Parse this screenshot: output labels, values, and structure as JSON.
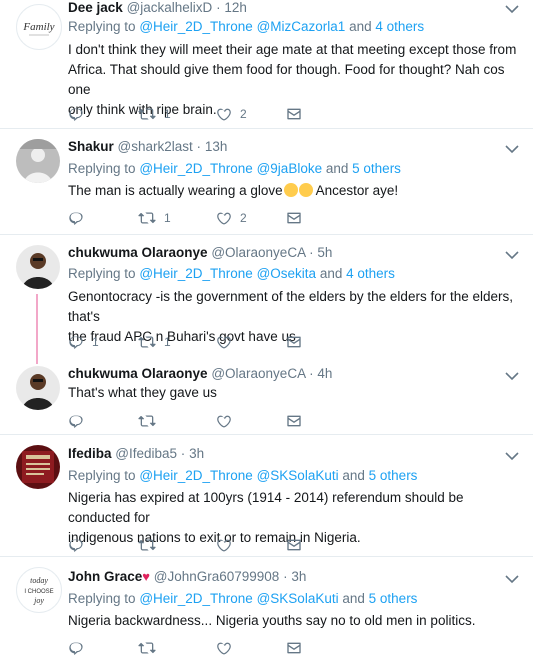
{
  "reply_prefix": "Replying to",
  "and_word": "and",
  "tweets": [
    {
      "name": "Dee jack",
      "handle": "@jackalhelixD",
      "time": "12h",
      "mentions": [
        "@Heir_2D_Throne",
        "@MizCazorla1"
      ],
      "others": "4 others",
      "text_lines": [
        "I don't think they will meet their age mate at that meeting except those from",
        "Africa. That should give them food for though. Food for thought? Nah cos one",
        "only think with ripe brain."
      ],
      "retweets": "1",
      "likes": "2",
      "avatar_text": "Family"
    },
    {
      "name": "Shakur",
      "handle": "@shark2last",
      "time": "13h",
      "mentions": [
        "@Heir_2D_Throne",
        "@9jaBloke"
      ],
      "others": "5 others",
      "text_before": "The man is actually wearing a glove",
      "text_after": " Ancestor aye!",
      "retweets": "1",
      "likes": "2"
    },
    {
      "name": "chukwuma Olaraonye",
      "handle": "@OlaraonyeCA",
      "time": "5h",
      "mentions": [
        "@Heir_2D_Throne",
        "@Osekita"
      ],
      "others": "4 others",
      "text_lines": [
        "Genontocracy -is the government of the elders by the elders for the elders, that's",
        "the fraud APC n Buhari's govt have us"
      ],
      "replies": "1",
      "retweets": "1"
    },
    {
      "name": "chukwuma Olaraonye",
      "handle": "@OlaraonyeCA",
      "time": "4h",
      "text_lines": [
        "That's what they gave us"
      ]
    },
    {
      "name": "Ifediba",
      "handle": "@Ifediba5",
      "time": "3h",
      "mentions": [
        "@Heir_2D_Throne",
        "@SKSolaKuti"
      ],
      "others": "5 others",
      "text_lines": [
        "Nigeria has expired at 100yrs (1914 - 2014) referendum should be conducted for",
        "indigenous nations to exit or to remain in Nigeria."
      ]
    },
    {
      "name": "John Grace",
      "handle": "@JohnGra60799908",
      "time": "3h",
      "mentions": [
        "@Heir_2D_Throne",
        "@SKSolaKuti"
      ],
      "others": "5 others",
      "text_lines": [
        "Nigeria backwardness... Nigeria youths say no to old men in politics."
      ],
      "avatar_lines": [
        "today",
        "I CHOOSE",
        "joy"
      ]
    }
  ],
  "dot": "·",
  "colors": {
    "link": "#1da1f2",
    "secondary": "#657786",
    "thread": "#f2a7c8",
    "heart": "#e0245e"
  }
}
